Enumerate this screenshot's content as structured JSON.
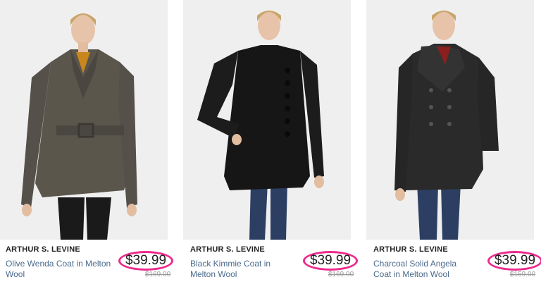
{
  "products": [
    {
      "brand": "ARTHUR S. LEVINE",
      "name": "Olive Wenda Coat in Melton Wool",
      "sale_price": "$39.99",
      "original_price": "$169.00",
      "coat_color": "#5b564c",
      "image_alt": "Model wearing Olive Wenda Coat"
    },
    {
      "brand": "ARTHUR S. LEVINE",
      "name": "Black Kimmie Coat in Melton Wool",
      "sale_price": "$39.99",
      "original_price": "$169.00",
      "coat_color": "#161616",
      "image_alt": "Model wearing Black Kimmie Coat"
    },
    {
      "brand": "ARTHUR S. LEVINE",
      "name": "Charcoal Solid Angela Coat in Melton Wool",
      "sale_price": "$39.99",
      "original_price": "$159.00",
      "coat_color": "#2a2a2a",
      "image_alt": "Model wearing Charcoal Solid Angela Coat"
    }
  ],
  "colors": {
    "highlight": "#ee2a8d",
    "link": "#4a6a8c",
    "jeans": "#2c3f63"
  }
}
